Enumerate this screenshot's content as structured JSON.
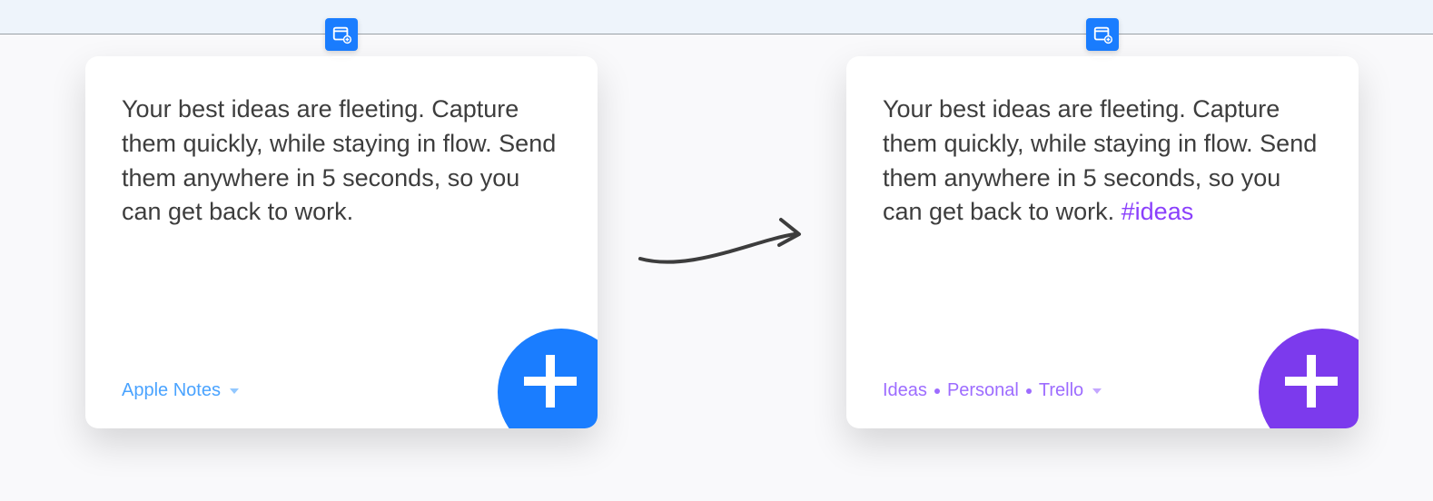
{
  "cards": {
    "left": {
      "body_text": "Your best ideas are fleeting. Capture them quickly, while staying in flow. Send them anywhere in 5 seconds, so you can get back to work.",
      "hashtag": "",
      "destination": {
        "items": [
          "Apple Notes"
        ],
        "color": "blue"
      },
      "accent_color": "#1a7dff"
    },
    "right": {
      "body_text": "Your best ideas are fleeting. Capture them quickly, while staying in flow. Send them anywhere in 5 seconds, so you can get back to work.",
      "hashtag": "#ideas",
      "destination": {
        "items": [
          "Ideas",
          "Personal",
          "Trello"
        ],
        "color": "purple"
      },
      "accent_color": "#7c3aed"
    }
  },
  "icons": {
    "menu_bar_icon": "new-window-icon",
    "add_button_icon": "plus-icon",
    "dropdown_icon": "chevron-down-icon",
    "transition_icon": "arrow-right-icon"
  }
}
